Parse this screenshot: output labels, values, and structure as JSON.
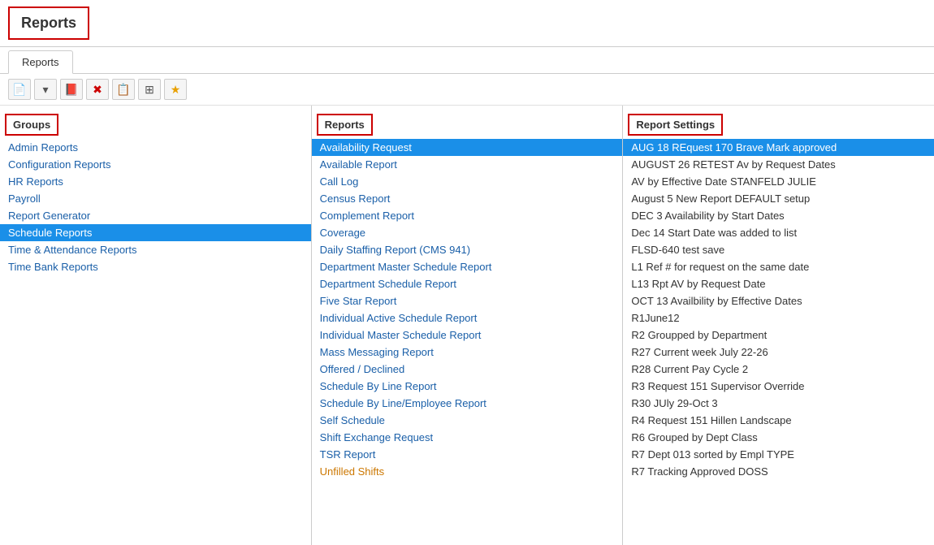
{
  "title": "Reports",
  "tab": "Reports",
  "toolbar": {
    "buttons": [
      {
        "name": "new-doc",
        "icon": "📄",
        "class": ""
      },
      {
        "name": "dropdown",
        "icon": "▾",
        "class": ""
      },
      {
        "name": "pdf",
        "icon": "📕",
        "class": "red-icon"
      },
      {
        "name": "delete",
        "icon": "✖",
        "class": "red-icon"
      },
      {
        "name": "copy",
        "icon": "📋",
        "class": "green-icon"
      },
      {
        "name": "table",
        "icon": "▦",
        "class": ""
      },
      {
        "name": "star",
        "icon": "★",
        "class": "orange-icon"
      }
    ]
  },
  "panels": {
    "groups": {
      "header": "Groups",
      "items": [
        {
          "label": "Admin Reports",
          "selected": false,
          "style": "normal"
        },
        {
          "label": "Configuration Reports",
          "selected": false,
          "style": "normal"
        },
        {
          "label": "HR Reports",
          "selected": false,
          "style": "normal"
        },
        {
          "label": "Payroll",
          "selected": false,
          "style": "normal"
        },
        {
          "label": "Report Generator",
          "selected": false,
          "style": "normal"
        },
        {
          "label": "Schedule Reports",
          "selected": true,
          "style": "normal"
        },
        {
          "label": "Time & Attendance Reports",
          "selected": false,
          "style": "normal"
        },
        {
          "label": "Time Bank Reports",
          "selected": false,
          "style": "normal"
        }
      ]
    },
    "reports": {
      "header": "Reports",
      "items": [
        {
          "label": "Availability Request",
          "selected": true,
          "style": "selected"
        },
        {
          "label": "Available Report",
          "selected": false,
          "style": "normal"
        },
        {
          "label": "Call Log",
          "selected": false,
          "style": "normal"
        },
        {
          "label": "Census Report",
          "selected": false,
          "style": "normal"
        },
        {
          "label": "Complement Report",
          "selected": false,
          "style": "normal"
        },
        {
          "label": "Coverage",
          "selected": false,
          "style": "normal"
        },
        {
          "label": "Daily Staffing Report (CMS 941)",
          "selected": false,
          "style": "normal"
        },
        {
          "label": "Department Master Schedule Report",
          "selected": false,
          "style": "normal"
        },
        {
          "label": "Department Schedule Report",
          "selected": false,
          "style": "normal"
        },
        {
          "label": "Five Star Report",
          "selected": false,
          "style": "normal"
        },
        {
          "label": "Individual Active Schedule Report",
          "selected": false,
          "style": "normal"
        },
        {
          "label": "Individual Master Schedule Report",
          "selected": false,
          "style": "normal"
        },
        {
          "label": "Mass Messaging Report",
          "selected": false,
          "style": "normal"
        },
        {
          "label": "Offered / Declined",
          "selected": false,
          "style": "normal"
        },
        {
          "label": "Schedule By Line Report",
          "selected": false,
          "style": "normal"
        },
        {
          "label": "Schedule By Line/Employee Report",
          "selected": false,
          "style": "normal"
        },
        {
          "label": "Self Schedule",
          "selected": false,
          "style": "normal"
        },
        {
          "label": "Shift Exchange Request",
          "selected": false,
          "style": "normal"
        },
        {
          "label": "TSR Report",
          "selected": false,
          "style": "normal"
        },
        {
          "label": "Unfilled Shifts",
          "selected": false,
          "style": "orange"
        }
      ]
    },
    "settings": {
      "header": "Report Settings",
      "items": [
        {
          "label": "AUG 18 REquest 170 Brave Mark approved",
          "selected": true,
          "style": "selected"
        },
        {
          "label": "AUGUST 26 RETEST Av by Request Dates",
          "selected": false,
          "style": "normal"
        },
        {
          "label": "AV by Effective Date STANFELD JULIE",
          "selected": false,
          "style": "normal"
        },
        {
          "label": "August 5 New Report DEFAULT setup",
          "selected": false,
          "style": "normal"
        },
        {
          "label": "DEC 3 Availability by Start Dates",
          "selected": false,
          "style": "normal"
        },
        {
          "label": "Dec 14 Start Date was added to list",
          "selected": false,
          "style": "normal"
        },
        {
          "label": "FLSD-640 test save",
          "selected": false,
          "style": "normal"
        },
        {
          "label": "L1 Ref # for request on the same date",
          "selected": false,
          "style": "normal"
        },
        {
          "label": "L13 Rpt AV by Request Date",
          "selected": false,
          "style": "normal"
        },
        {
          "label": "OCT 13 Availbility by Effective Dates",
          "selected": false,
          "style": "normal"
        },
        {
          "label": "R1June12",
          "selected": false,
          "style": "normal"
        },
        {
          "label": "R2 Groupped by Department",
          "selected": false,
          "style": "normal"
        },
        {
          "label": "R27 Current week July 22-26",
          "selected": false,
          "style": "normal"
        },
        {
          "label": "R28 Current Pay Cycle 2",
          "selected": false,
          "style": "normal"
        },
        {
          "label": "R3 Request 151 Supervisor Override",
          "selected": false,
          "style": "normal"
        },
        {
          "label": "R30 JUly 29-Oct 3",
          "selected": false,
          "style": "normal"
        },
        {
          "label": "R4 Request 151 Hillen Landscape",
          "selected": false,
          "style": "normal"
        },
        {
          "label": "R6 Grouped by Dept Class",
          "selected": false,
          "style": "normal"
        },
        {
          "label": "R7 Dept 013 sorted by Empl TYPE",
          "selected": false,
          "style": "normal"
        },
        {
          "label": "R7 Tracking Approved DOSS",
          "selected": false,
          "style": "normal"
        }
      ]
    }
  }
}
